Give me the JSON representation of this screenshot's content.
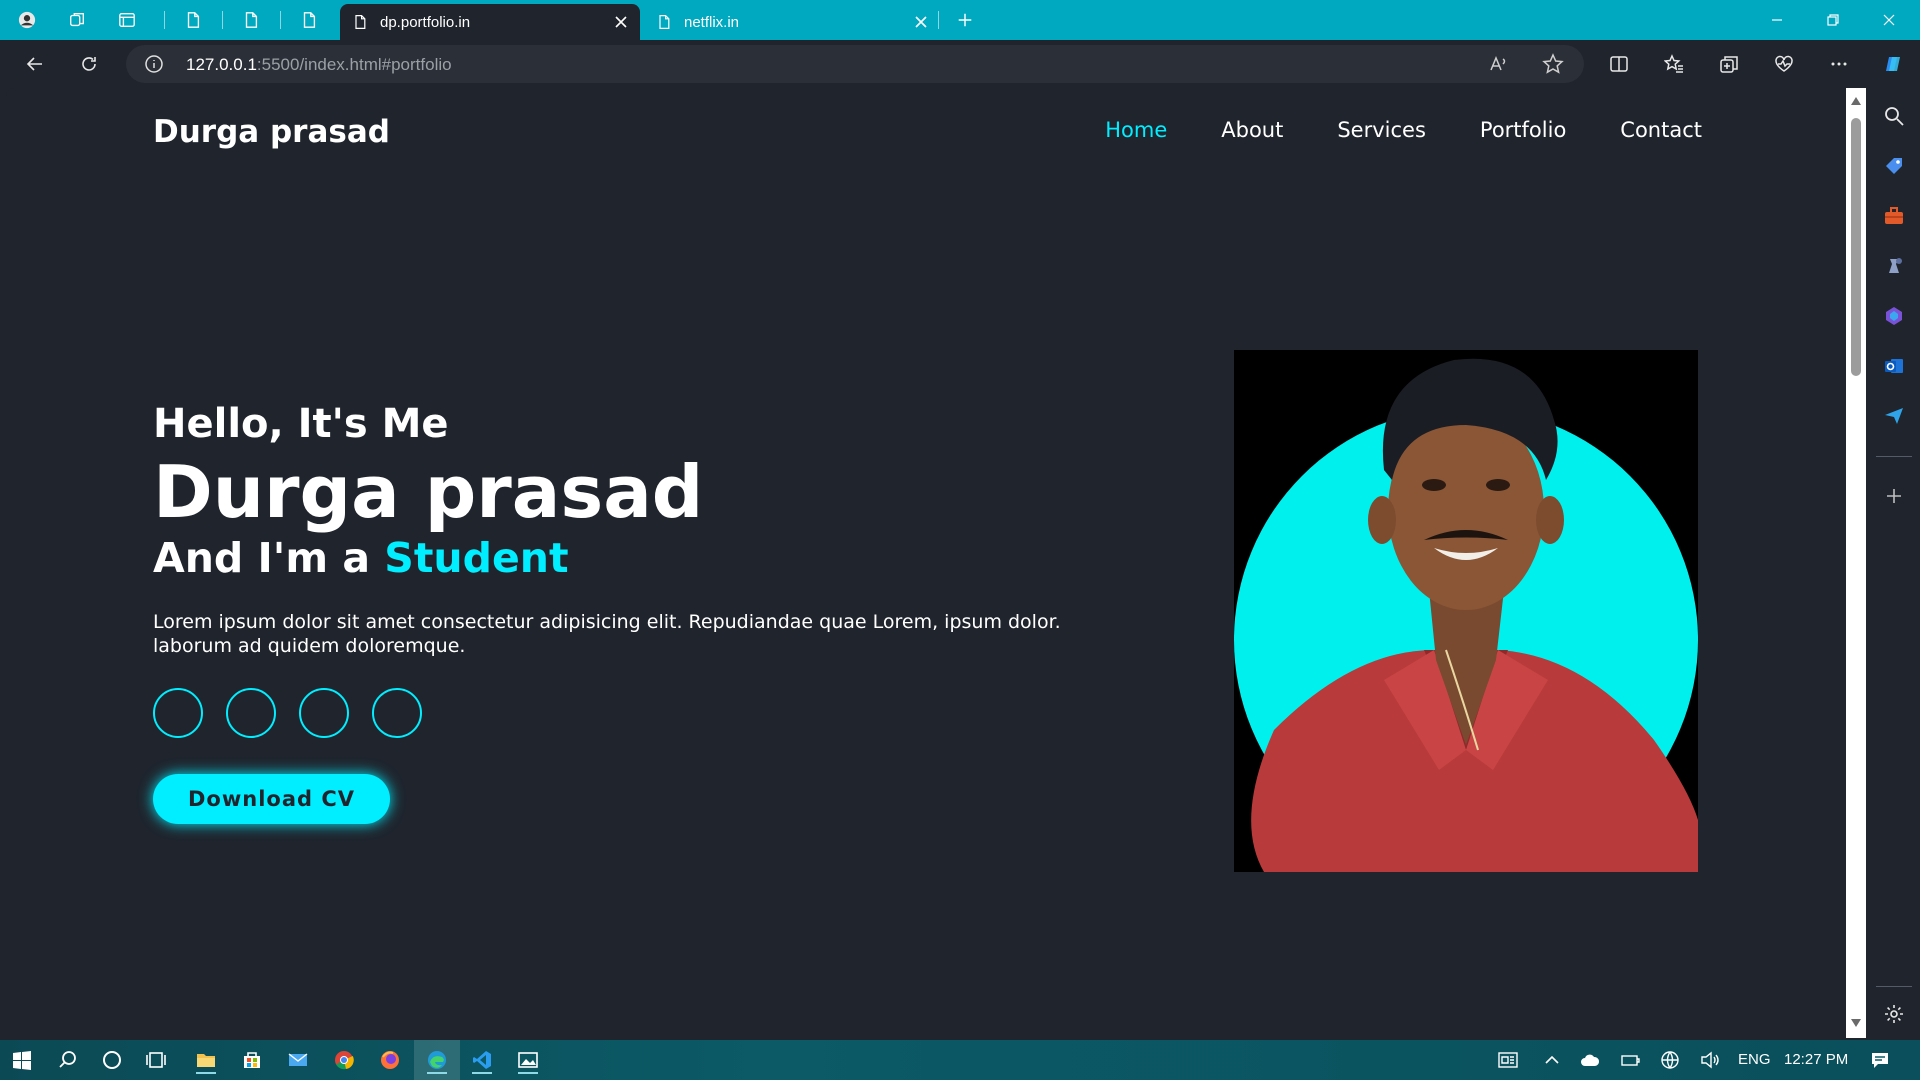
{
  "browser": {
    "tabs": [
      {
        "title": "dp.portfolio.in",
        "active": true
      },
      {
        "title": "netflix.in",
        "active": false
      }
    ],
    "url": {
      "host": "127.0.0.1",
      "path": ":5500/index.html#portfolio"
    }
  },
  "site": {
    "logo": "Durga prasad",
    "nav": [
      {
        "label": "Home",
        "active": true
      },
      {
        "label": "About",
        "active": false
      },
      {
        "label": "Services",
        "active": false
      },
      {
        "label": "Portfolio",
        "active": false
      },
      {
        "label": "Contact",
        "active": false
      }
    ],
    "hero": {
      "greeting": "Hello, It's Me",
      "name": "Durga prasad",
      "role_prefix": "And I'm a",
      "role_highlight": "Student",
      "description": "Lorem ipsum dolor sit amet consectetur adipisicing elit. Repudiandae quae Lorem, ipsum dolor. laborum ad quidem doloremque.",
      "social_count": 4,
      "cta_label": "Download CV"
    },
    "accent_color": "#00eeff",
    "background_color": "#1f242d"
  },
  "taskbar": {
    "language": "ENG",
    "time": "12:27 PM"
  }
}
